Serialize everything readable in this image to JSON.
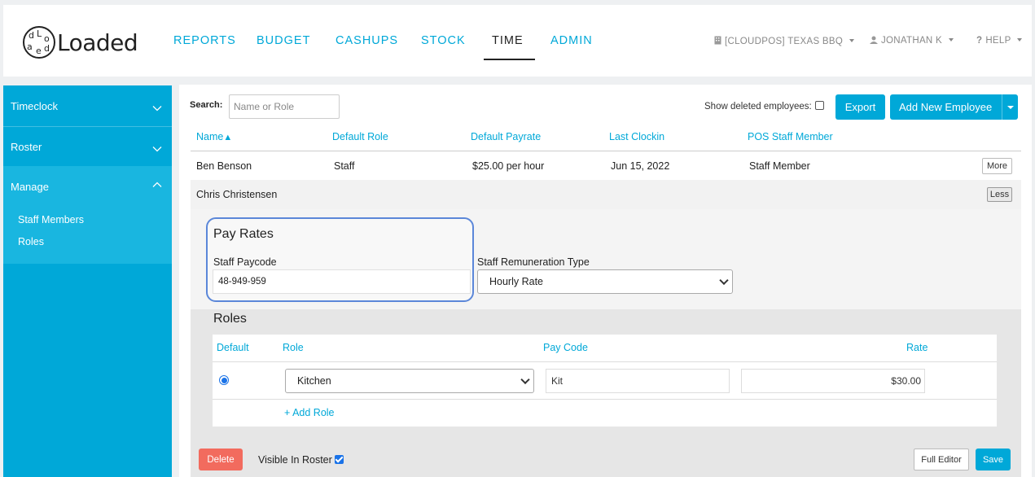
{
  "app": {
    "logo_text": "Loaded",
    "logo_mark_letters": [
      "d",
      "L",
      "o",
      "a",
      "e",
      "d"
    ]
  },
  "nav": {
    "items": [
      {
        "label": "REPORTS",
        "active": false
      },
      {
        "label": "BUDGET",
        "active": false
      },
      {
        "label": "CASHUPS",
        "active": false
      },
      {
        "label": "STOCK",
        "active": false
      },
      {
        "label": "TIME",
        "active": true
      },
      {
        "label": "ADMIN",
        "active": false
      }
    ],
    "store": "[CLOUDPOS] TEXAS BBQ",
    "user": "JONATHAN K",
    "help": "HELP",
    "icons": {
      "store": "building-icon",
      "user": "user-icon",
      "help": "question-icon"
    }
  },
  "sidebar": {
    "sections": [
      {
        "label": "Timeclock",
        "expanded": false
      },
      {
        "label": "Roster",
        "expanded": false
      },
      {
        "label": "Manage",
        "expanded": true
      }
    ],
    "manage_links": [
      "Staff Members",
      "Roles"
    ]
  },
  "toolbar": {
    "search_label": "Search:",
    "search_placeholder": "Name or Role",
    "show_deleted_label": "Show deleted employees:",
    "show_deleted_checked": false,
    "export_label": "Export",
    "add_new_label": "Add New Employee"
  },
  "table": {
    "columns": [
      "Name",
      "Default Role",
      "Default Payrate",
      "Last Clockin",
      "POS Staff Member"
    ],
    "sort_indicator": "▲",
    "rows": [
      {
        "name": "Ben Benson",
        "role": "Staff",
        "payrate": "$25.00 per hour",
        "last_clockin": "Jun 15, 2022",
        "pos": "Staff Member",
        "toggle": "More"
      },
      {
        "name": "Chris Christensen",
        "role": "",
        "payrate": "",
        "last_clockin": "",
        "pos": "",
        "toggle": "Less"
      }
    ]
  },
  "detail": {
    "pay_rates_title": "Pay Rates",
    "staff_paycode_label": "Staff Paycode",
    "staff_paycode_value": "48-949-959",
    "remuneration_label": "Staff Remuneration Type",
    "remuneration_value": "Hourly Rate",
    "roles_title": "Roles",
    "roles_columns": [
      "Default",
      "Role",
      "Pay Code",
      "Rate"
    ],
    "roles_rows": [
      {
        "default": true,
        "role": "Kitchen",
        "pay_code": "Kit",
        "rate": "$30.00"
      }
    ],
    "add_role_label": "+ Add Role",
    "delete_label": "Delete",
    "visible_in_roster_label": "Visible In Roster",
    "visible_in_roster_checked": true,
    "full_editor_label": "Full Editor",
    "save_label": "Save"
  },
  "colors": {
    "accent": "#00a8d8",
    "sidebar_active": "#19b6e0",
    "delete": "#f26b5e",
    "highlight_border": "#5b87d9"
  }
}
